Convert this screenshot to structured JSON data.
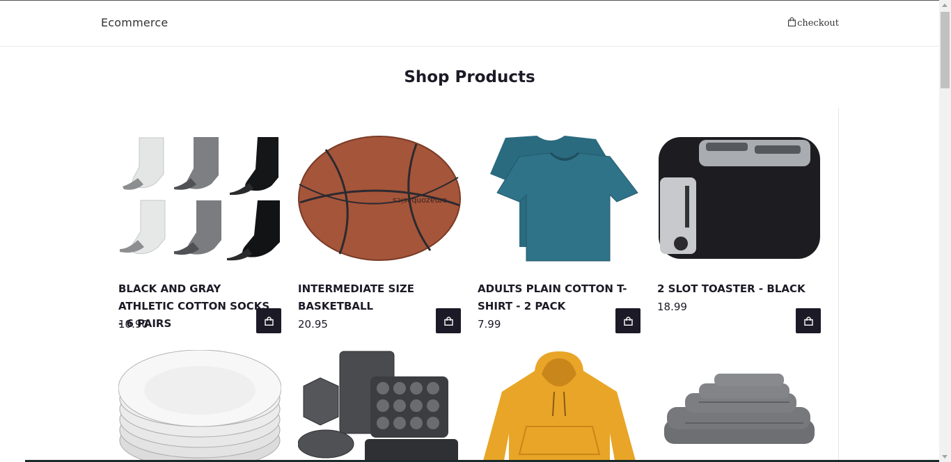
{
  "navbar": {
    "brand": "Ecommerce",
    "checkout_label": "checkout",
    "checkout_icon": "shopping-bag-icon"
  },
  "page": {
    "title": "Shop Products"
  },
  "products": [
    {
      "name": "BLACK AND GRAY ATHLETIC COTTON SOCKS - 6 PAIRS",
      "price": "10.90",
      "image": "socks-image"
    },
    {
      "name": "INTERMEDIATE SIZE BASKETBALL",
      "price": "20.95",
      "image": "basketball-image"
    },
    {
      "name": "ADULTS PLAIN COTTON T-SHIRT - 2 PACK",
      "price": "7.99",
      "image": "tshirt-image"
    },
    {
      "name": "2 SLOT TOASTER - BLACK",
      "price": "18.99",
      "image": "toaster-image"
    },
    {
      "name": "",
      "price": "",
      "image": "plates-image"
    },
    {
      "name": "",
      "price": "",
      "image": "bakeware-image"
    },
    {
      "name": "",
      "price": "",
      "image": "hoodie-image"
    },
    {
      "name": "",
      "price": "",
      "image": "towels-image"
    }
  ],
  "colors": {
    "accent": "#1b1a26",
    "background": "#ffffff"
  }
}
